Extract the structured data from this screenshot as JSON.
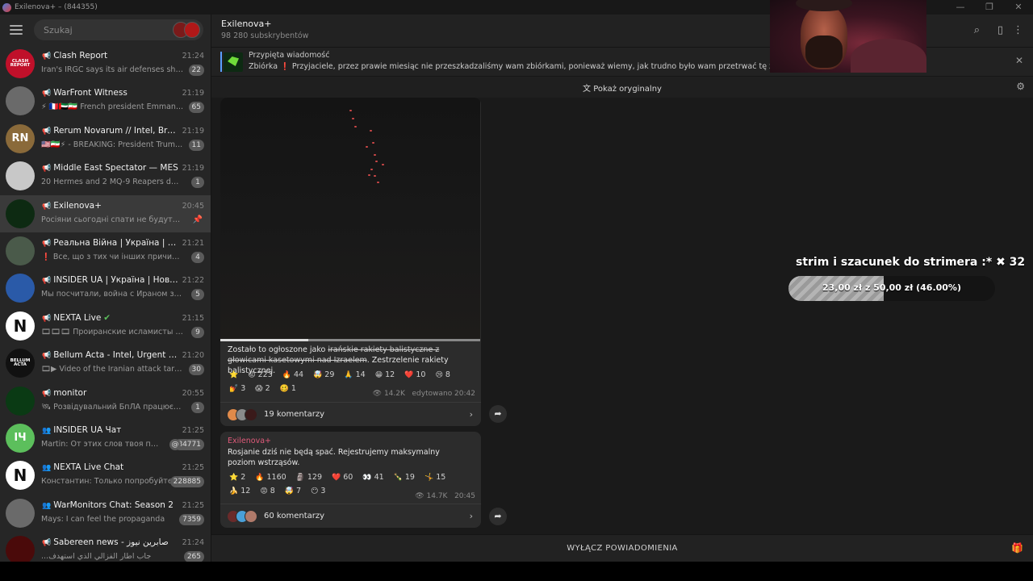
{
  "window": {
    "title": "Exilenova+ – (844355)"
  },
  "sidebar": {
    "search_placeholder": "Szukaj",
    "chats": [
      {
        "name": "Clash Report",
        "prefix": "📢",
        "time": "21:24",
        "preview": "Iran's IRGC says its air defenses shot d...",
        "badge": "22",
        "avatar_text": "CLASH REPORT",
        "avatar_color": "#c0102a"
      },
      {
        "name": "WarFront Witness",
        "prefix": "📢",
        "time": "21:19",
        "preview": "⚡ 🇫🇷🇦🇪🇮🇷 French president Emman...",
        "badge": "65",
        "avatar_text": "",
        "avatar_color": "#6a6a6a"
      },
      {
        "name": "Rerum Novarum // Intel, Breakin...",
        "prefix": "📢",
        "time": "21:19",
        "preview": "🇺🇸🇮🇷⚡ - BREAKING: President Trum...",
        "badge": "11",
        "avatar_text": "RN",
        "avatar_color": "#8a6a3a"
      },
      {
        "name": "Middle East Spectator — MES",
        "prefix": "📢",
        "time": "21:19",
        "preview": "20 Hermes and 2 MQ-9 Reapers downe...",
        "badge": "1",
        "avatar_text": "",
        "avatar_color": "#c8c8c8"
      },
      {
        "name": "Exilenova+",
        "prefix": "📢",
        "time": "20:45",
        "preview": "Росіяни сьогодні спати не будуть. Фік...",
        "badge": "",
        "pinned": true,
        "active": true,
        "avatar_text": "",
        "avatar_color": "#0d2a12"
      },
      {
        "name": "Реальна Війна | Україна | Нови...",
        "prefix": "📢",
        "time": "21:21",
        "preview": "❗ Все, що з тих чи інших причин не ...",
        "badge": "4",
        "avatar_text": "",
        "avatar_color": "#4a5a4a"
      },
      {
        "name": "INSIDER UA | Україна | Новини",
        "prefix": "📢",
        "time": "21:22",
        "preview": "Мы посчитали, война с Ираном займ...",
        "badge": "5",
        "avatar_text": "",
        "avatar_color": "#2a5aa8"
      },
      {
        "name": "NEXTA Live",
        "prefix": "📢",
        "time": "21:15",
        "preview": "🎞🎞🎞 Проиранские исламисты пы...",
        "badge": "9",
        "verified": true,
        "avatar_text": "N",
        "avatar_color": "#ffffff"
      },
      {
        "name": "Bellum Acta - Intel, Urgent News ...",
        "prefix": "📢",
        "time": "21:20",
        "preview": "🎞▶ Video of the Iranian attack targe...",
        "badge": "30",
        "avatar_text": "BELLUM ACTA",
        "avatar_color": "#111111"
      },
      {
        "name": "monitor",
        "prefix": "📢",
        "time": "20:55",
        "preview": "🛰 Розвідувальний БпЛА працює поб...",
        "badge": "1",
        "avatar_text": "",
        "avatar_color": "#0a3a14"
      },
      {
        "name": "INSIDER UA Чат",
        "prefix": "👥",
        "time": "21:25",
        "preview": "Martin: От этих слов твоя при...",
        "badge": "84771",
        "mention": true,
        "avatar_text": "IЧ",
        "avatar_color": "#5cbf5c"
      },
      {
        "name": "NEXTA Live Chat",
        "prefix": "👥",
        "time": "21:25",
        "preview": "Константин: Только попробуйте ...",
        "badge": "228885",
        "avatar_text": "N",
        "avatar_color": "#ffffff"
      },
      {
        "name": "WarMonitors Chat: Season 2",
        "prefix": "👥",
        "time": "21:25",
        "preview": "Mays: I can feel the propaganda",
        "badge": "7359",
        "avatar_text": "",
        "avatar_color": "#6a6a6a"
      },
      {
        "name": "Sabereen news - صابرين نيوز",
        "prefix": "📢",
        "time": "21:24",
        "preview": "...جاب اطار الفزالي الذي استهدف",
        "badge": "265",
        "avatar_text": "",
        "avatar_color": "#4a0a0a"
      }
    ]
  },
  "header": {
    "title": "Exilenova+",
    "subscribers": "98 280 subskrybentów"
  },
  "pinned": {
    "label": "Przypięta wiadomość",
    "text": "Zbiórka ❗ Przyjaciele, przez prawie miesiąc nie przeszkadzaliśmy wam zbiórkami, ponieważ wiemy, jak trudno było wam przetrwać tę zimę. A... właśnie na waszyc..."
  },
  "translate_bar": {
    "label": "Pokaż oryginalny"
  },
  "messages": [
    {
      "text_plain": "Zostało to ogłoszone jako ",
      "text_strike": "irańskie rakiety balistyczne z głowicami kasetowymi nad Izraelem",
      "text_after": ". Zestrzelenie rakiety balistycznej.",
      "reactions": [
        {
          "emoji": "⭐",
          "count": ""
        },
        {
          "emoji": "😡",
          "count": "223"
        },
        {
          "emoji": "🔥",
          "count": "44"
        },
        {
          "emoji": "🤯",
          "count": "29"
        },
        {
          "emoji": "🙏",
          "count": "14"
        },
        {
          "emoji": "😁",
          "count": "12"
        },
        {
          "emoji": "❤️",
          "count": "10"
        },
        {
          "emoji": "😢",
          "count": "8"
        },
        {
          "emoji": "💅",
          "count": "3"
        },
        {
          "emoji": "😱",
          "count": "2"
        },
        {
          "emoji": "🥴",
          "count": "1"
        }
      ],
      "views": "14.2K",
      "edited_time": "edytowano 20:42",
      "comments": "19 komentarzy",
      "video_progress": 0.34
    },
    {
      "sender": "Exilenova+",
      "text": "Rosjanie dziś nie będą spać. Rejestrujemy maksymalny poziom wstrząsów.",
      "reactions": [
        {
          "emoji": "⭐",
          "count": "2"
        },
        {
          "emoji": "🔥",
          "count": "1160"
        },
        {
          "emoji": "🗿",
          "count": "129"
        },
        {
          "emoji": "❤️",
          "count": "60"
        },
        {
          "emoji": "👀",
          "count": "41"
        },
        {
          "emoji": "🍾",
          "count": "19"
        },
        {
          "emoji": "🤸",
          "count": "15"
        },
        {
          "emoji": "🍌",
          "count": "12"
        },
        {
          "emoji": "😡",
          "count": "8"
        },
        {
          "emoji": "🤯",
          "count": "7"
        },
        {
          "emoji": "😶",
          "count": "3"
        }
      ],
      "views": "14.7K",
      "time": "20:45",
      "comments": "60 komentarzy"
    }
  ],
  "bottom_bar": {
    "label": "WYŁĄCZ POWIADOMIENIA"
  },
  "overlay": {
    "donation_title": "strim i szacunek do strimera :*",
    "donation_count": "32",
    "goal_text": "23,00 zł z 50,00 zł (46.00%)",
    "goal_progress": 0.46
  },
  "colors": {
    "accent": "#5aa0ff",
    "sender": "#e05a7a",
    "active_chat": "#3a3a3a",
    "badge": "#5a5a5a"
  }
}
